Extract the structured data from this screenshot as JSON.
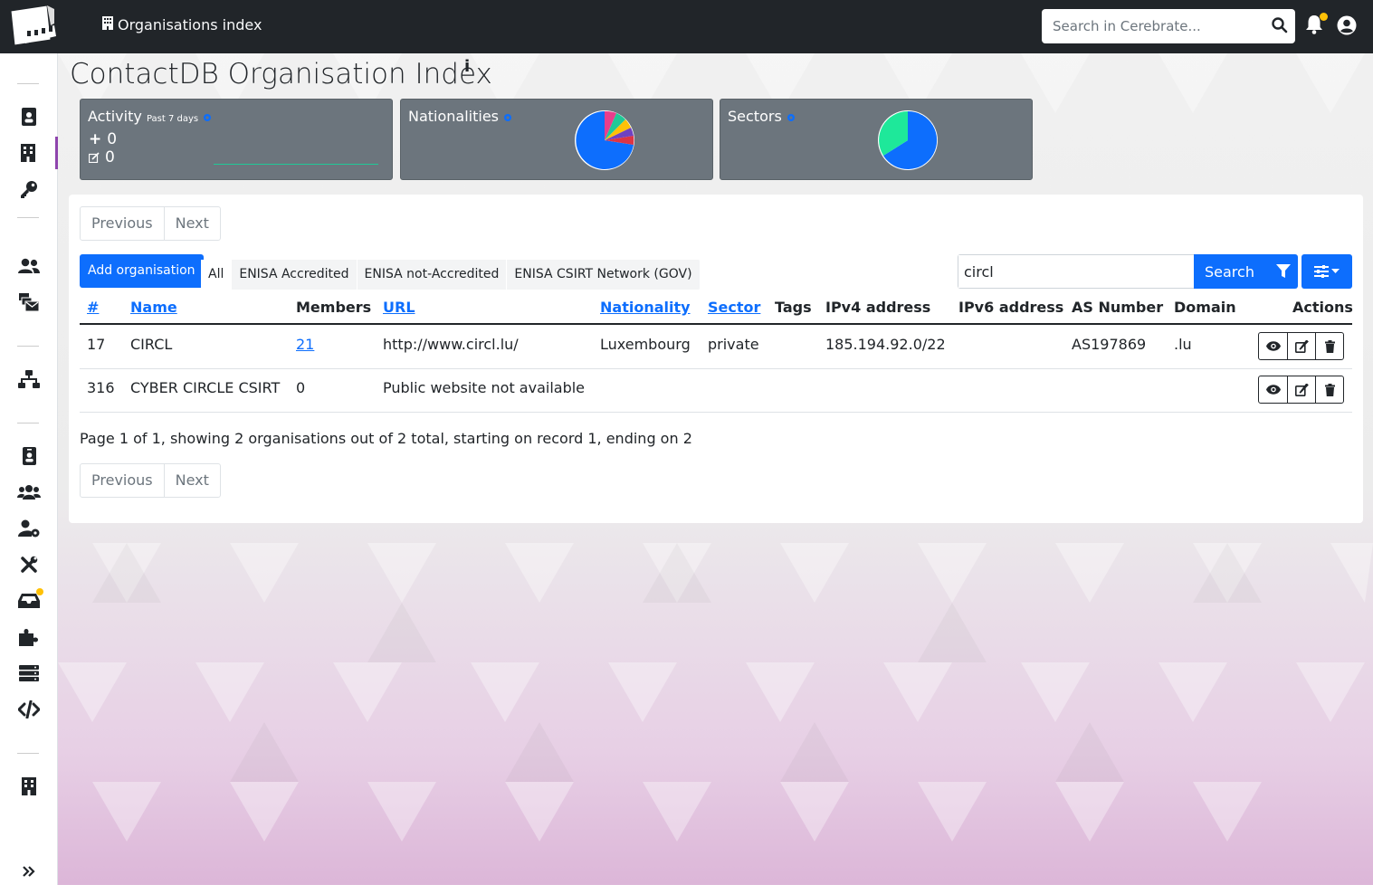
{
  "topbar": {
    "breadcrumb": "Organisations index",
    "search_placeholder": "Search in Cerebrate..."
  },
  "page": {
    "title": "ContactDB Organisation Index",
    "info_glyph": "i"
  },
  "stats": {
    "activity": {
      "label": "Activity",
      "period": "Past 7 days",
      "added": "0",
      "modified": "0",
      "added_icon": "+"
    },
    "nationalities": {
      "label": "Nationalities"
    },
    "sectors": {
      "label": "Sectors"
    }
  },
  "pager": {
    "previous": "Previous",
    "next": "Next"
  },
  "toolbar": {
    "add_label": "Add organisation",
    "filters": [
      "All",
      "ENISA Accredited",
      "ENISA not-Accredited",
      "ENISA CSIRT Network (GOV)"
    ],
    "search_value": "circl",
    "search_button": "Search"
  },
  "table": {
    "headers": [
      "#",
      "Name",
      "Members",
      "URL",
      "Nationality",
      "Sector",
      "Tags",
      "IPv4 address",
      "IPv6 address",
      "AS Number",
      "Domain",
      "Actions"
    ],
    "rows": [
      {
        "id": "17",
        "name": "CIRCL",
        "members": "21",
        "url": "http://www.circl.lu/",
        "nationality": "Luxembourg",
        "sector": "private",
        "tags": "",
        "ipv4": "185.194.92.0/22",
        "ipv6": "",
        "asn": "AS197869",
        "domain": ".lu"
      },
      {
        "id": "316",
        "name": "CYBER CIRCLE CSIRT",
        "members": "0",
        "url": "Public website not available",
        "nationality": "",
        "sector": "",
        "tags": "",
        "ipv4": "",
        "ipv6": "",
        "asn": "",
        "domain": ""
      }
    ]
  },
  "summary": "Page 1 of 1, showing 2 organisations out of 2 total, starting on record 1, ending on 2",
  "colors": {
    "primary": "#0d6efd",
    "navbar": "#212529",
    "card": "#6c757d",
    "accent": "#8e44ad"
  },
  "icons": [
    "app-logo",
    "building-icon",
    "search-icon",
    "bell-icon",
    "user-circle-icon",
    "address-book-icon",
    "key-icon",
    "users-icon",
    "mail-bulk-icon",
    "network-icon",
    "id-badge-icon",
    "user-group-icon",
    "user-cog-icon",
    "tools-icon",
    "inbox-icon",
    "puzzle-icon",
    "server-icon",
    "code-icon",
    "chevrons-right-icon",
    "cog-icon",
    "filter-icon",
    "sliders-icon",
    "eye-icon",
    "edit-icon",
    "trash-icon"
  ]
}
